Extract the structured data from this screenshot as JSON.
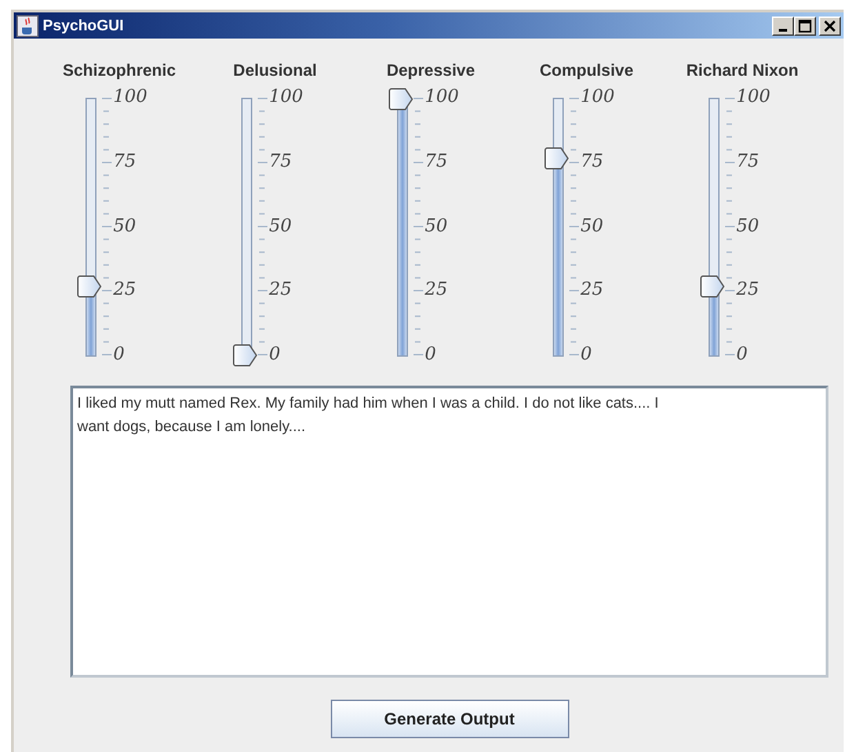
{
  "window": {
    "title": "PsychoGUI"
  },
  "sliders": [
    {
      "label": "Schizophrenic",
      "level": 0.27,
      "ticks": [
        "100",
        "75",
        "50",
        "25",
        "0"
      ]
    },
    {
      "label": "Delusional",
      "level": 0,
      "ticks": [
        "100",
        "75",
        "50",
        "25",
        "0"
      ]
    },
    {
      "label": "Depressive",
      "level": 1,
      "ticks": [
        "100",
        "75",
        "50",
        "25",
        "0"
      ]
    },
    {
      "label": "Compulsive",
      "level": 0.77,
      "ticks": [
        "100",
        "75",
        "50",
        "25",
        "0"
      ]
    },
    {
      "label": "Richard Nixon",
      "level": 0.27,
      "ticks": [
        "100",
        "75",
        "50",
        "25",
        "0"
      ]
    }
  ],
  "output": {
    "value": "I liked my mutt named Rex. My family had him when I was a child. I do not like cats.... I want dogs, because I am lonely...."
  },
  "buttons": [
    "Generate Output"
  ]
}
